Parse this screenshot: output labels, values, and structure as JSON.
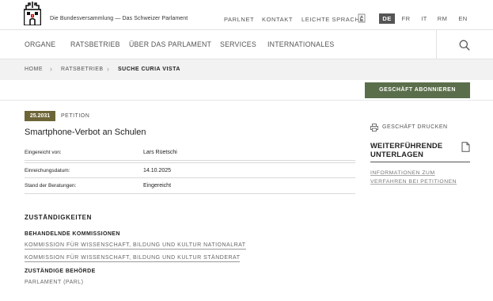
{
  "header": {
    "site_title": "Die Bundesversammlung — Das Schweizer Parlament",
    "top_links": [
      "PARLNET",
      "KONTAKT",
      "LEICHTE SPRACHE"
    ],
    "languages": [
      "DE",
      "FR",
      "IT",
      "RM",
      "EN"
    ],
    "active_language": "DE"
  },
  "nav": {
    "items": [
      "ORGANE",
      "RATSBETRIEB",
      "ÜBER DAS PARLAMENT",
      "SERVICES",
      "INTERNATIONALES"
    ]
  },
  "breadcrumb": [
    "HOME",
    "RATSBETRIEB",
    "SUCHE CURIA VISTA"
  ],
  "actions": {
    "subscribe_label": "GESCHÄFT ABONNIEREN"
  },
  "business": {
    "number": "25.2031",
    "type": "PETITION",
    "title": "Smartphone-Verbot an Schulen",
    "meta": [
      {
        "label": "Eingereicht von:",
        "value": "Lars Rüetschi"
      },
      {
        "label": "Einreichungsdatum:",
        "value": "14.10.2025"
      },
      {
        "label": "Stand der Beratungen:",
        "value": "Eingereicht"
      }
    ]
  },
  "sidebar": {
    "print_label": "GESCHÄFT DRUCKEN",
    "further_title": "WEITERFÜHRENDE UNTERLAGEN",
    "further_link": "INFORMATIONEN ZUM VERFAHREN BEI PETITIONEN"
  },
  "responsibilities": {
    "title": "ZUSTÄNDIGKEITEN",
    "committees_title": "BEHANDELNDE KOMMISSIONEN",
    "committees": [
      "KOMMISSION FÜR WISSENSCHAFT, BILDUNG UND KULTUR NATIONALRAT",
      "KOMMISSION FÜR WISSENSCHAFT, BILDUNG UND KULTUR STÄNDERAT"
    ],
    "authority_title": "ZUSTÄNDIGE BEHÖRDE",
    "authority": "PARLAMENT (PARL)"
  },
  "colors": {
    "button_green": "#5b6e4b",
    "badge_olive": "#6e6537",
    "language_active": "#555555"
  }
}
